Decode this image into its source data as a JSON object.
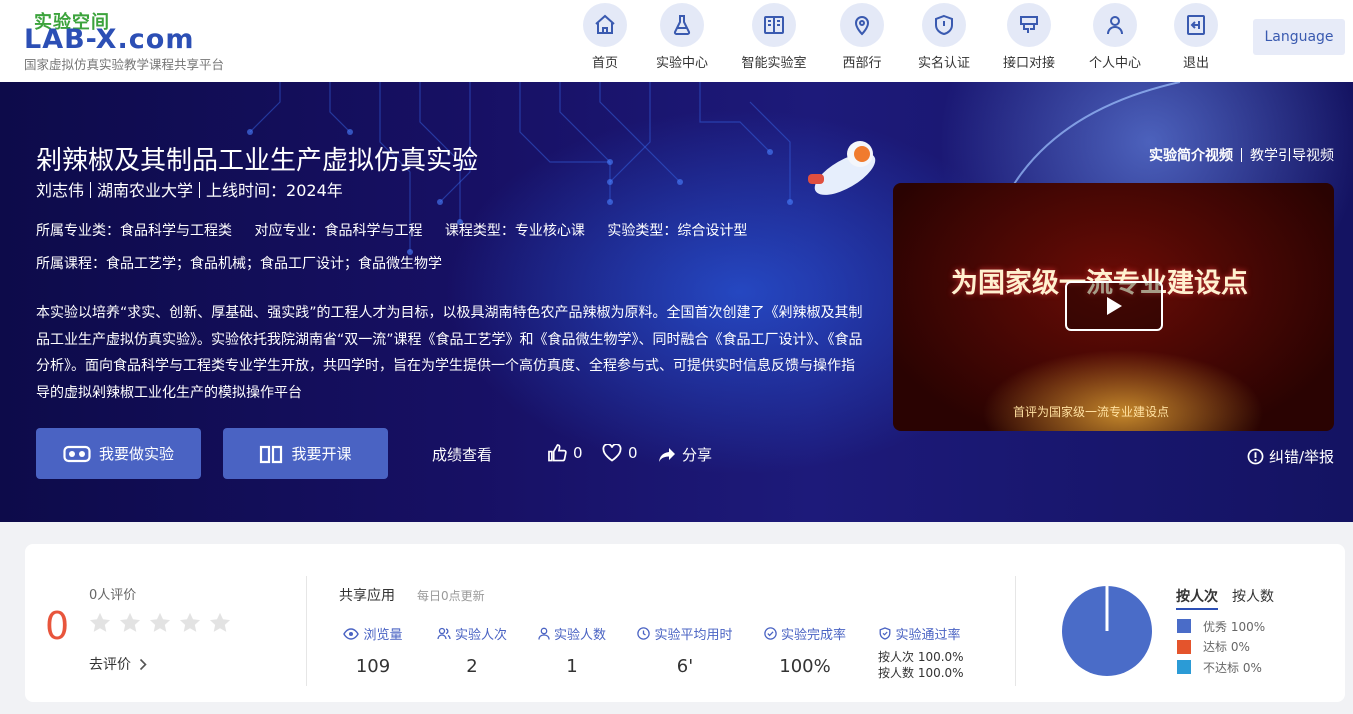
{
  "header": {
    "logo": {
      "cn": "实验空间",
      "en": "LAB-X.com",
      "subtitle": "国家虚拟仿真实验教学课程共享平台"
    },
    "nav": [
      {
        "label": "首页",
        "icon": "home-icon"
      },
      {
        "label": "实验中心",
        "icon": "flask-icon"
      },
      {
        "label": "智能实验室",
        "icon": "book-icon"
      },
      {
        "label": "西部行",
        "icon": "map-pin-icon"
      },
      {
        "label": "实名认证",
        "icon": "shield-icon"
      },
      {
        "label": "接口对接",
        "icon": "interface-icon"
      },
      {
        "label": "个人中心",
        "icon": "user-icon"
      },
      {
        "label": "退出",
        "icon": "logout-icon"
      }
    ],
    "language_label": "Language"
  },
  "hero": {
    "title": "剁辣椒及其制品工业生产虚拟仿真实验",
    "author": "刘志伟",
    "school": "湖南农业大学",
    "online": "上线时间：2024年",
    "major_category": "所属专业类：食品科学与工程类",
    "major": "对应专业：食品科学与工程",
    "course_type": "课程类型：专业核心课",
    "exp_type": "实验类型：综合设计型",
    "courses": "所属课程：食品工艺学；食品机械；食品工厂设计；食品微生物学",
    "description": "本实验以培养“求实、创新、厚基础、强实践”的工程人才为目标，以极具湖南特色农产品辣椒为原料。全国首次创建了《剁辣椒及其制品工业生产虚拟仿真实验》。实验依托我院湖南省“双一流”课程《食品工艺学》和《食品微生物学》、同时融合《食品工厂设计》、《食品分析》。面向食品科学与工程类专业学生开放，共四学时，旨在为学生提供一个高仿真度、全程参与式、可提供实时信息反馈与操作指导的虚拟剁辣椒工业化生产的模拟操作平台",
    "btn_do": "我要做实验",
    "btn_open": "我要开课",
    "score_link": "成绩查看",
    "likes": "0",
    "favorites": "0",
    "share": "分享",
    "video_links": {
      "intro": "实验简介视频",
      "guide": "教学引导视频"
    },
    "video_text": "为国家级一流专业建设点",
    "video_sub": "首评为国家级一流专业建设点",
    "report": "纠错/举报"
  },
  "stats": {
    "score": "0",
    "eval_count": "0人评价",
    "go_eval": "去评价",
    "share_title": "共享应用",
    "update_note": "每日0点更新",
    "items": [
      {
        "label": "浏览量",
        "value": "109"
      },
      {
        "label": "实验人次",
        "value": "2"
      },
      {
        "label": "实验人数",
        "value": "1"
      },
      {
        "label": "实验平均用时",
        "value": "6'"
      },
      {
        "label": "实验完成率",
        "value": "100%"
      },
      {
        "label": "实验通过率",
        "value": ""
      }
    ],
    "pass_by_times": "按人次 100.0%",
    "pass_by_people": "按人数 100.0%",
    "tabs": [
      "按人次",
      "按人数"
    ],
    "legend": [
      {
        "label": "优秀 100%",
        "color": "#4a6cc8",
        "fraction": 1.0
      },
      {
        "label": "达标 0%",
        "color": "#e4542c",
        "fraction": 0
      },
      {
        "label": "不达标 0%",
        "color": "#2b9bd6",
        "fraction": 0
      }
    ]
  }
}
